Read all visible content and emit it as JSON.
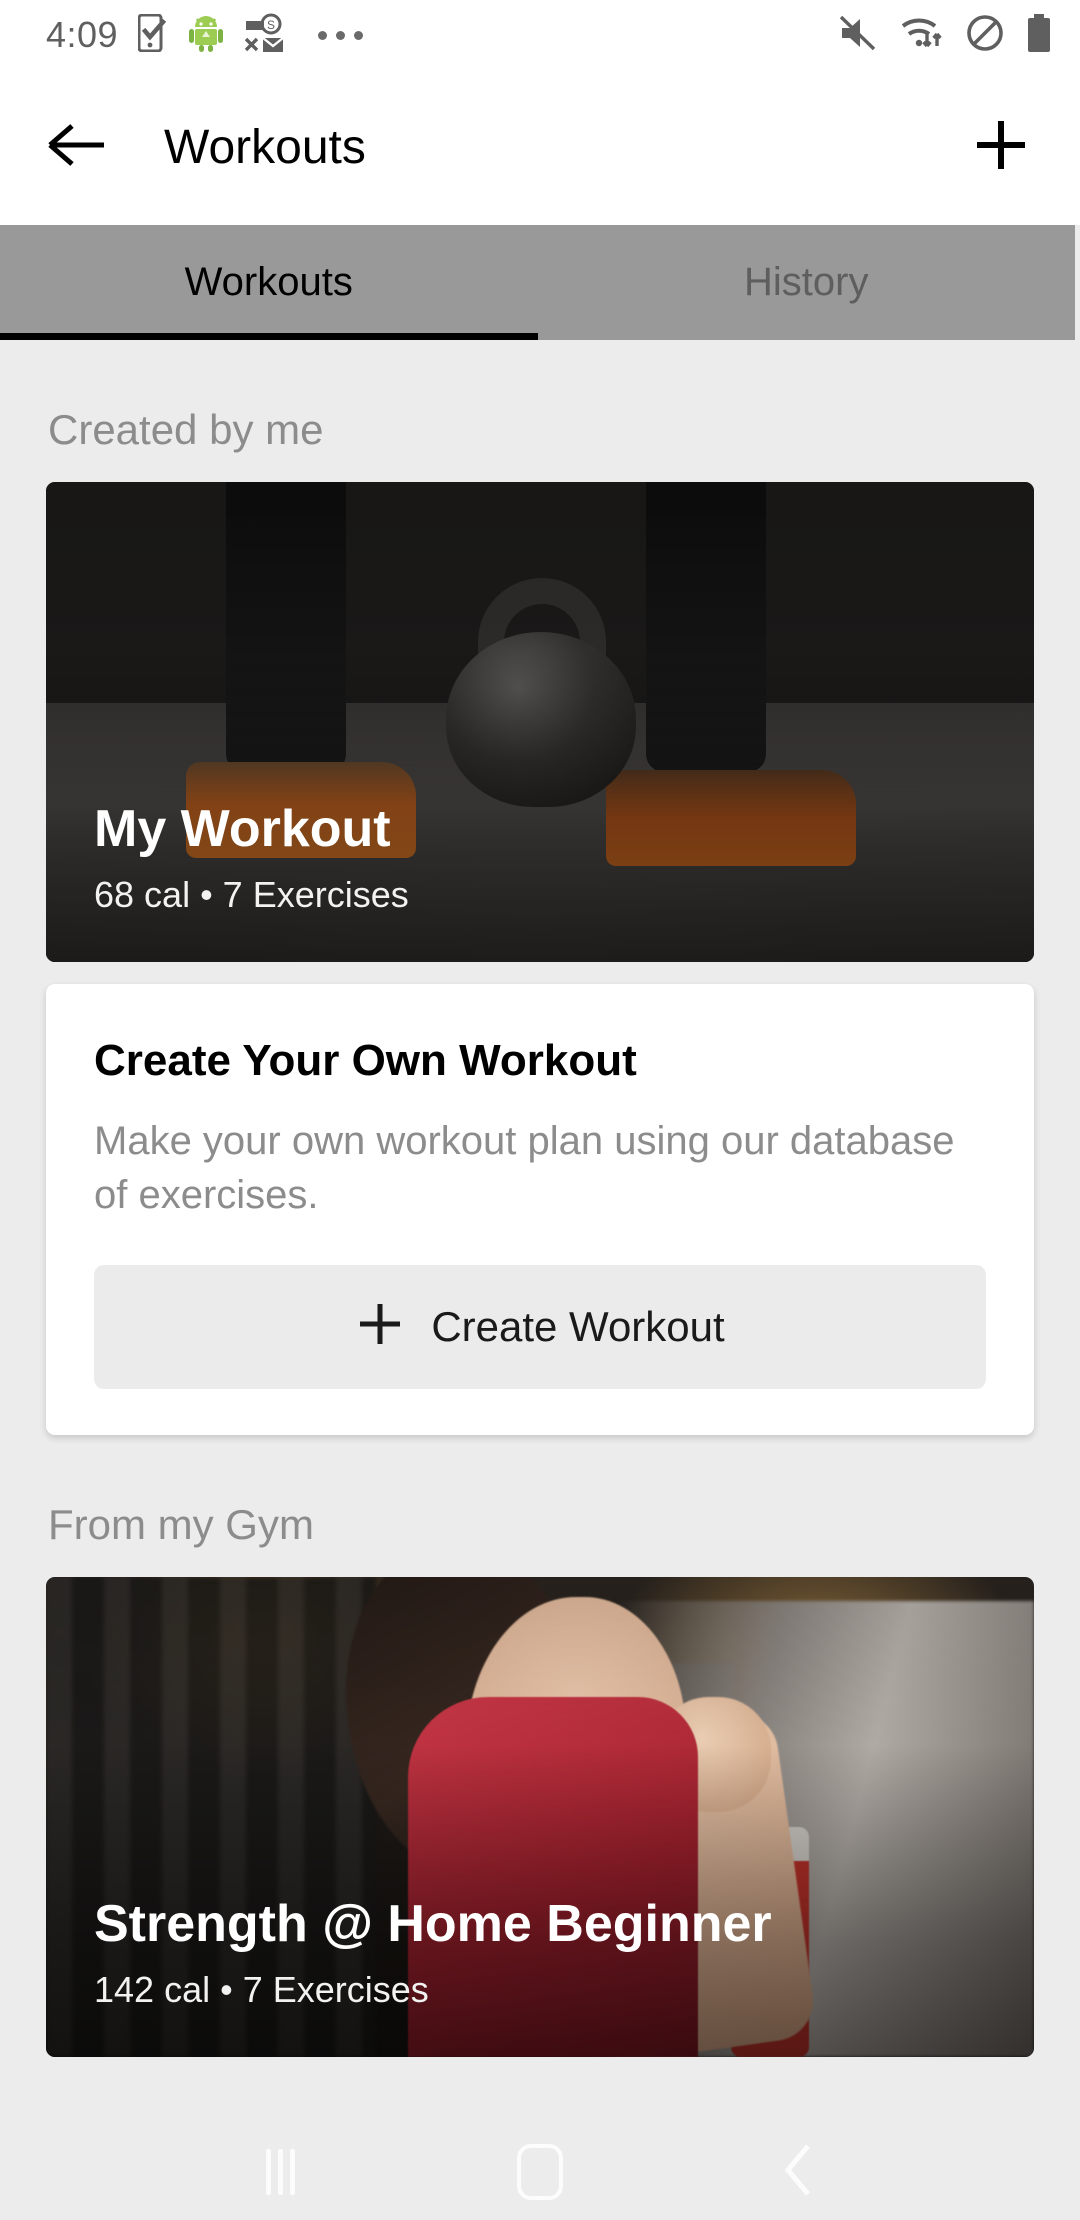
{
  "status_bar": {
    "time": "4:09",
    "left_icons": [
      "phone-check-icon",
      "android-robot-icon",
      "vpn-key-mail-icon",
      "more-dots-icon"
    ],
    "right_icons": [
      "volume-mute-icon",
      "wifi-icon",
      "do-not-disturb-icon",
      "battery-icon"
    ]
  },
  "app_bar": {
    "title": "Workouts",
    "back_icon": "arrow-back-icon",
    "add_icon": "plus-icon"
  },
  "tabs": {
    "selected": "Workouts",
    "items": [
      {
        "label": "Workouts",
        "active": true
      },
      {
        "label": "History",
        "active": false
      }
    ]
  },
  "sections": [
    {
      "title": "Created by me",
      "workout": {
        "name": "My Workout",
        "calories": "68 cal",
        "separator": "•",
        "exercises": "7 Exercises",
        "meta": "68 cal • 7 Exercises",
        "art": "kettlebell-photo"
      },
      "create_card": {
        "title": "Create Your Own Workout",
        "description": "Make your own workout plan using our database of exercises.",
        "button_label": "Create Workout",
        "button_icon": "plus-icon"
      }
    },
    {
      "title": "From my Gym",
      "workout": {
        "name": "Strength @ Home Beginner",
        "calories": "142 cal",
        "separator": "•",
        "exercises": "7 Exercises",
        "meta": "142 cal • 7 Exercises",
        "art": "gym-treadmill-photo"
      }
    }
  ],
  "nav_bar": {
    "recents_icon": "recents-icon",
    "home_icon": "home-icon",
    "back_icon": "back-chevron-icon"
  },
  "colors": {
    "page_background": "#ececec",
    "tab_bar": "#999999",
    "card_surface": "#ffffff",
    "button_surface": "#ebebeb",
    "muted_text": "#8c8c8c",
    "primary_text": "#000000"
  }
}
